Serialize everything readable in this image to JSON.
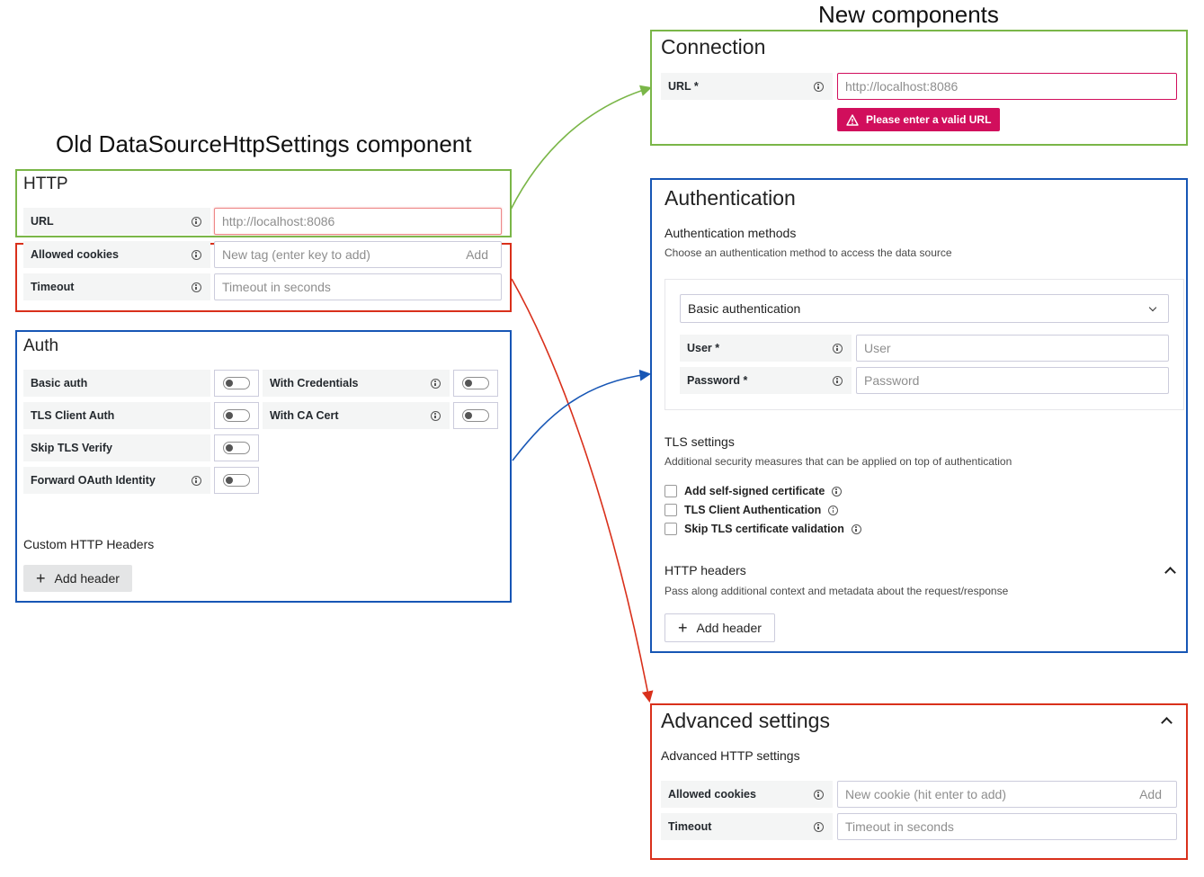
{
  "headings": {
    "new_components": "New components",
    "old_component": "Old DataSourceHttpSettings component"
  },
  "old": {
    "http": {
      "title": "HTTP",
      "url_label": "URL",
      "url_placeholder": "http://localhost:8086"
    },
    "misc": {
      "allowed_cookies_label": "Allowed cookies",
      "allowed_cookies_placeholder": "New tag (enter key to add)",
      "allowed_cookies_add": "Add",
      "timeout_label": "Timeout",
      "timeout_placeholder": "Timeout in seconds"
    },
    "auth": {
      "title": "Auth",
      "basic_auth": "Basic auth",
      "with_credentials": "With Credentials",
      "tls_client_auth": "TLS Client Auth",
      "with_ca_cert": "With CA Cert",
      "skip_tls_verify": "Skip TLS Verify",
      "forward_oauth": "Forward OAuth Identity",
      "custom_headers_title": "Custom HTTP Headers",
      "add_header": "Add header"
    }
  },
  "new": {
    "connection": {
      "title": "Connection",
      "url_label": "URL *",
      "url_placeholder": "http://localhost:8086",
      "error": "Please enter a valid URL"
    },
    "authentication": {
      "title": "Authentication",
      "methods_title": "Authentication methods",
      "methods_desc": "Choose an authentication method to access the data source",
      "method_selected": "Basic authentication",
      "user_label": "User *",
      "user_placeholder": "User",
      "password_label": "Password *",
      "password_placeholder": "Password",
      "tls_title": "TLS settings",
      "tls_desc": "Additional security measures that can be applied on top of authentication",
      "tls_options": [
        "Add self-signed certificate",
        "TLS Client Authentication",
        "Skip TLS certificate validation"
      ],
      "headers_title": "HTTP headers",
      "headers_desc": "Pass along additional context and metadata about the request/response",
      "add_header": "Add header"
    },
    "advanced": {
      "title": "Advanced settings",
      "subtitle": "Advanced HTTP settings",
      "allowed_cookies_label": "Allowed cookies",
      "allowed_cookies_placeholder": "New cookie (hit enter to add)",
      "allowed_cookies_add": "Add",
      "timeout_label": "Timeout",
      "timeout_placeholder": "Timeout in seconds"
    }
  },
  "colors": {
    "green": "#7ab648",
    "red": "#d9301b",
    "blue": "#1756b5",
    "error": "#d10e5c"
  }
}
